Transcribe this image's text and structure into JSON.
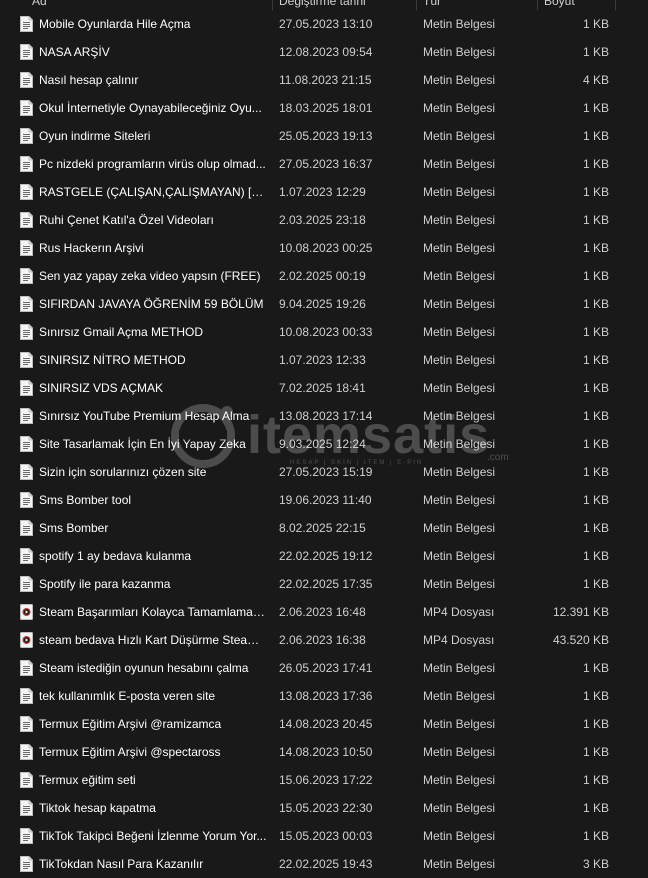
{
  "header": {
    "col_name": "Ad",
    "col_date": "Değiştirme tarihi",
    "col_type": "Tür",
    "col_size": "Boyut"
  },
  "watermark": {
    "brand": "itemsatis",
    "tagline": "HESAP | SKIN | ITEM | E-PIN",
    "suffix": ".com"
  },
  "files": [
    {
      "name": "Mobile Oyunlarda Hile Açma",
      "date": "27.05.2023 13:10",
      "type": "Metin Belgesi",
      "size": "1 KB",
      "icon": "text-file-icon"
    },
    {
      "name": "NASA ARŞİV",
      "date": "12.08.2023 09:54",
      "type": "Metin Belgesi",
      "size": "1 KB",
      "icon": "text-file-icon"
    },
    {
      "name": "Nasıl hesap çalınır",
      "date": "11.08.2023 21:15",
      "type": "Metin Belgesi",
      "size": "4 KB",
      "icon": "text-file-icon"
    },
    {
      "name": "Okul İnternetiyle Oynayabileceğiniz Oyu...",
      "date": "18.03.2025 18:01",
      "type": "Metin Belgesi",
      "size": "1 KB",
      "icon": "text-file-icon"
    },
    {
      "name": "Oyun indirme Siteleri",
      "date": "25.05.2023 19:13",
      "type": "Metin Belgesi",
      "size": "1 KB",
      "icon": "text-file-icon"
    },
    {
      "name": "Pc nizdeki programların virüs olup olmad...",
      "date": "27.05.2023 16:37",
      "type": "Metin Belgesi",
      "size": "1 KB",
      "icon": "text-file-icon"
    },
    {
      "name": "RASTGELE (ÇALIŞAN,ÇALIŞMAYAN) [MİN...",
      "date": "1.07.2023 12:29",
      "type": "Metin Belgesi",
      "size": "1 KB",
      "icon": "text-file-icon"
    },
    {
      "name": "Ruhi Çenet Katıl'a Özel Videoları",
      "date": "2.03.2025 23:18",
      "type": "Metin Belgesi",
      "size": "1 KB",
      "icon": "text-file-icon"
    },
    {
      "name": "Rus Hackerın Arşivi",
      "date": "10.08.2023 00:25",
      "type": "Metin Belgesi",
      "size": "1 KB",
      "icon": "text-file-icon"
    },
    {
      "name": "Sen yaz yapay zeka video yapsın (FREE)",
      "date": "2.02.2025 00:19",
      "type": "Metin Belgesi",
      "size": "1 KB",
      "icon": "text-file-icon"
    },
    {
      "name": "SIFIRDAN JAVAYA ÖĞRENİM 59 BÖLÜM",
      "date": "9.04.2025 19:26",
      "type": "Metin Belgesi",
      "size": "1 KB",
      "icon": "text-file-icon"
    },
    {
      "name": "Sınırsız Gmail Açma METHOD",
      "date": "10.08.2023 00:33",
      "type": "Metin Belgesi",
      "size": "1 KB",
      "icon": "text-file-icon"
    },
    {
      "name": "SINIRSIZ NİTRO METHOD",
      "date": "1.07.2023 12:33",
      "type": "Metin Belgesi",
      "size": "1 KB",
      "icon": "text-file-icon"
    },
    {
      "name": "SINIRSIZ VDS AÇMAK",
      "date": "7.02.2025 18:41",
      "type": "Metin Belgesi",
      "size": "1 KB",
      "icon": "text-file-icon"
    },
    {
      "name": "Sınırsız YouTube Premium Hesap Alma",
      "date": "13.08.2023 17:14",
      "type": "Metin Belgesi",
      "size": "1 KB",
      "icon": "text-file-icon"
    },
    {
      "name": "Site Tasarlamak İçin En İyi Yapay Zeka",
      "date": "9.03.2025 12:24",
      "type": "Metin Belgesi",
      "size": "1 KB",
      "icon": "text-file-icon"
    },
    {
      "name": "Sizin için sorularınızı çözen site",
      "date": "27.05.2023 15:19",
      "type": "Metin Belgesi",
      "size": "1 KB",
      "icon": "text-file-icon"
    },
    {
      "name": "Sms Bomber tool",
      "date": "19.06.2023 11:40",
      "type": "Metin Belgesi",
      "size": "1 KB",
      "icon": "text-file-icon"
    },
    {
      "name": "Sms Bomber",
      "date": "8.02.2025 22:15",
      "type": "Metin Belgesi",
      "size": "1 KB",
      "icon": "text-file-icon"
    },
    {
      "name": "spotify 1 ay bedava kulanma",
      "date": "22.02.2025 19:12",
      "type": "Metin Belgesi",
      "size": "1 KB",
      "icon": "text-file-icon"
    },
    {
      "name": "Spotify ile para kazanma",
      "date": "22.02.2025 17:35",
      "type": "Metin Belgesi",
      "size": "1 KB",
      "icon": "text-file-icon"
    },
    {
      "name": "Steam Başarımları Kolayca Tamamlama v...",
      "date": "2.06.2023 16:48",
      "type": "MP4 Dosyası",
      "size": "12.391 KB",
      "icon": "video-file-icon"
    },
    {
      "name": "steam bedava Hızlı Kart Düşürme Steam ...",
      "date": "2.06.2023 16:38",
      "type": "MP4 Dosyası",
      "size": "43.520 KB",
      "icon": "video-file-icon"
    },
    {
      "name": "Steam istediğin oyunun hesabını çalma",
      "date": "26.05.2023 17:41",
      "type": "Metin Belgesi",
      "size": "1 KB",
      "icon": "text-file-icon"
    },
    {
      "name": "tek kullanımlık E-posta veren site",
      "date": "13.08.2023 17:36",
      "type": "Metin Belgesi",
      "size": "1 KB",
      "icon": "text-file-icon"
    },
    {
      "name": "Termux Eğitim Arşivi @ramizamca",
      "date": "14.08.2023 20:45",
      "type": "Metin Belgesi",
      "size": "1 KB",
      "icon": "text-file-icon"
    },
    {
      "name": "Termux Eğitim Arşivi @spectaross",
      "date": "14.08.2023 10:50",
      "type": "Metin Belgesi",
      "size": "1 KB",
      "icon": "text-file-icon"
    },
    {
      "name": "Termux eğitim seti",
      "date": "15.06.2023 17:22",
      "type": "Metin Belgesi",
      "size": "1 KB",
      "icon": "text-file-icon"
    },
    {
      "name": "Tiktok hesap kapatma",
      "date": "15.05.2023 22:30",
      "type": "Metin Belgesi",
      "size": "1 KB",
      "icon": "text-file-icon"
    },
    {
      "name": "TikTok Takipci Beğeni İzlenme Yorum Yor...",
      "date": "15.05.2023 00:03",
      "type": "Metin Belgesi",
      "size": "1 KB",
      "icon": "text-file-icon"
    },
    {
      "name": "TikTokdan Nasıl Para Kazanılır",
      "date": "22.02.2025 19:43",
      "type": "Metin Belgesi",
      "size": "3 KB",
      "icon": "text-file-icon"
    }
  ]
}
